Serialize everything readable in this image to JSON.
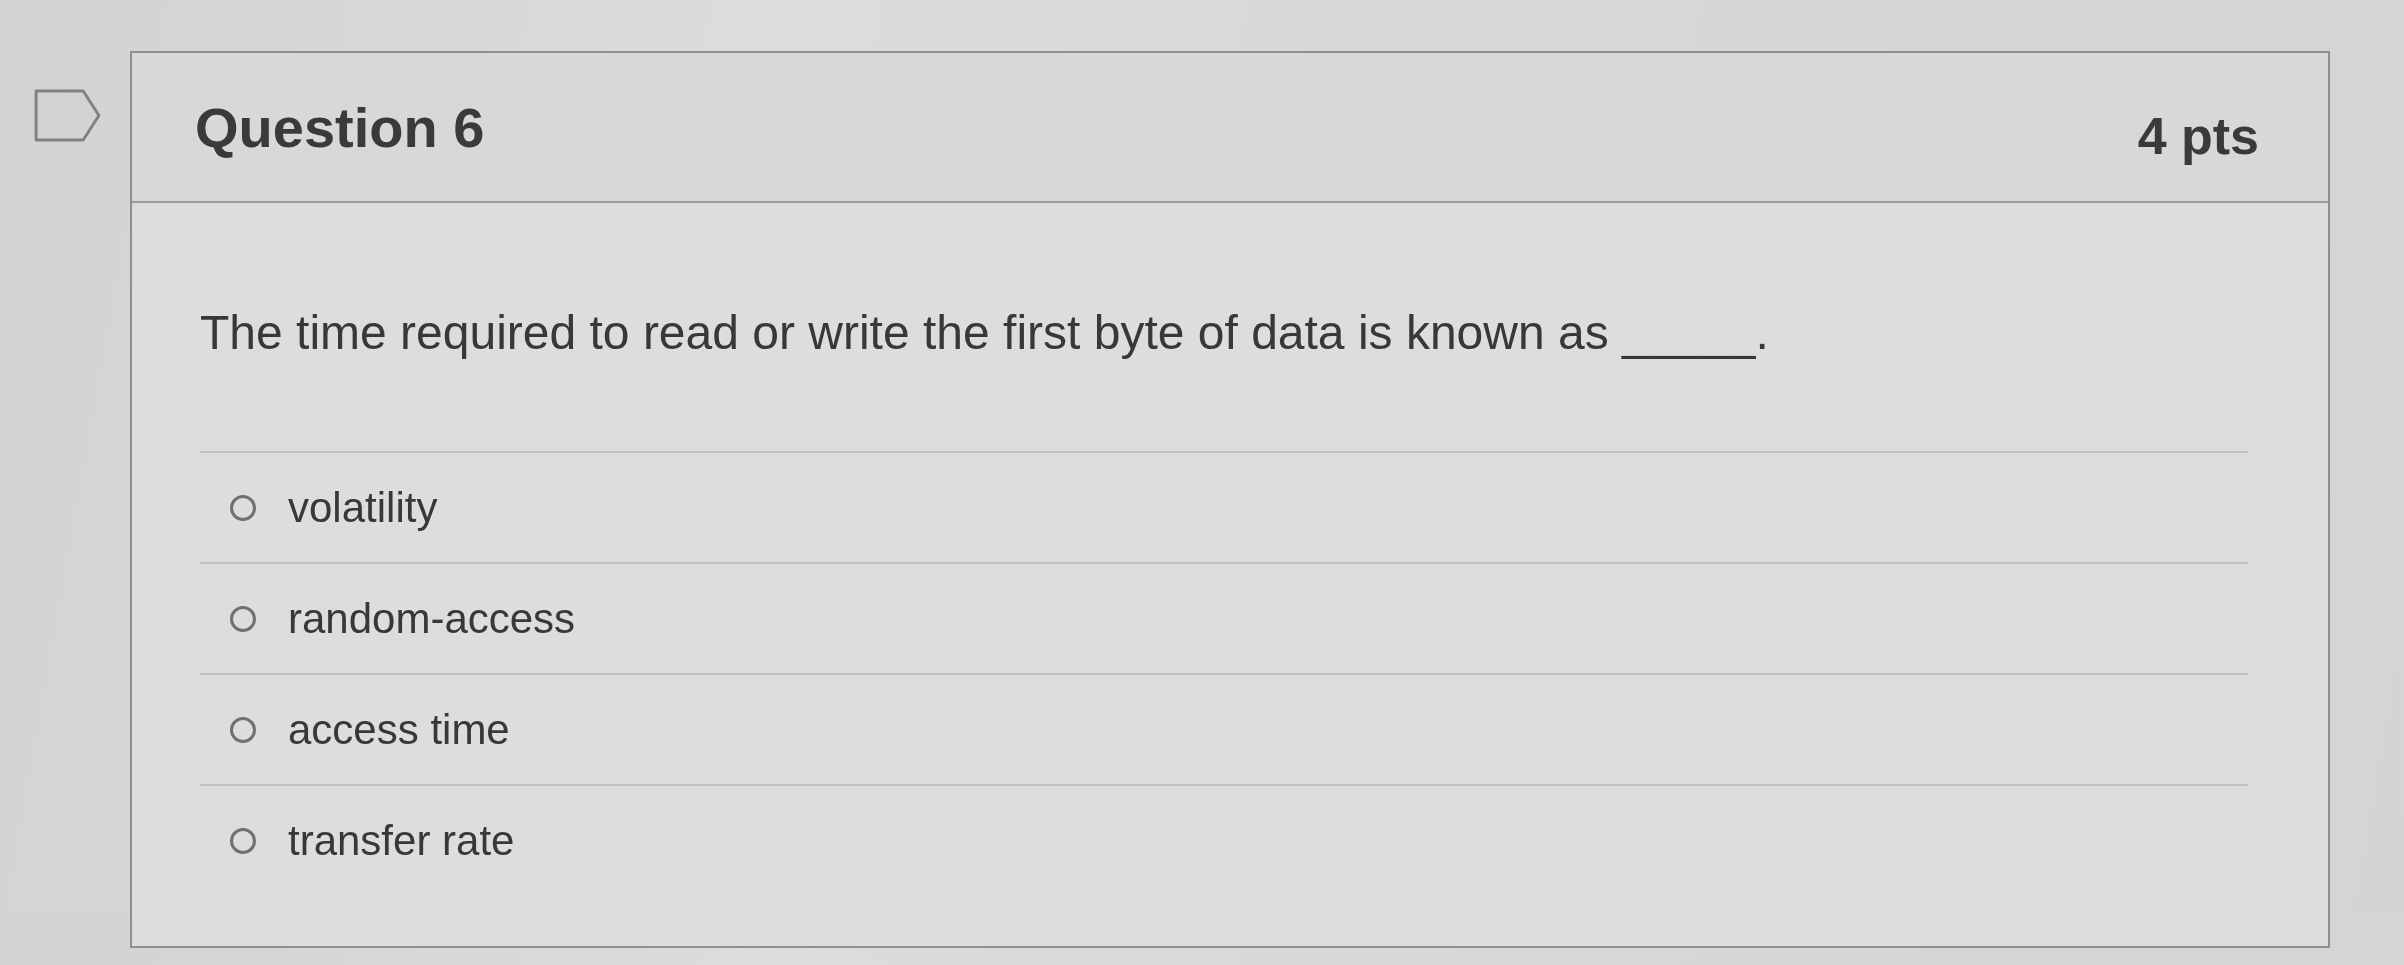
{
  "question": {
    "title": "Question 6",
    "points": "4 pts",
    "text": "The time required to read or write the first byte of data is known as _____.",
    "answers": [
      {
        "label": "volatility",
        "selected": false
      },
      {
        "label": "random-access",
        "selected": false
      },
      {
        "label": "access time",
        "selected": false
      },
      {
        "label": "transfer rate",
        "selected": false
      }
    ]
  }
}
